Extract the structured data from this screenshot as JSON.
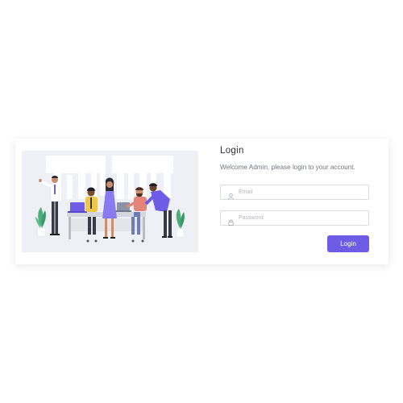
{
  "login": {
    "title": "Login",
    "subtitle": "Welcome Admin, please login to your account.",
    "email": {
      "placeholder": "Email",
      "value": ""
    },
    "password": {
      "placeholder": "Password",
      "value": ""
    },
    "submit_label": "Login"
  },
  "icons": {
    "email_field_icon": "user-icon",
    "password_field_icon": "lock-icon"
  },
  "colors": {
    "accent": "#6e5ce6",
    "illustration_background": "#eef0f5",
    "title_text": "#2e2f3a",
    "subtitle_text": "#707584",
    "field_border": "#d9dce4"
  }
}
